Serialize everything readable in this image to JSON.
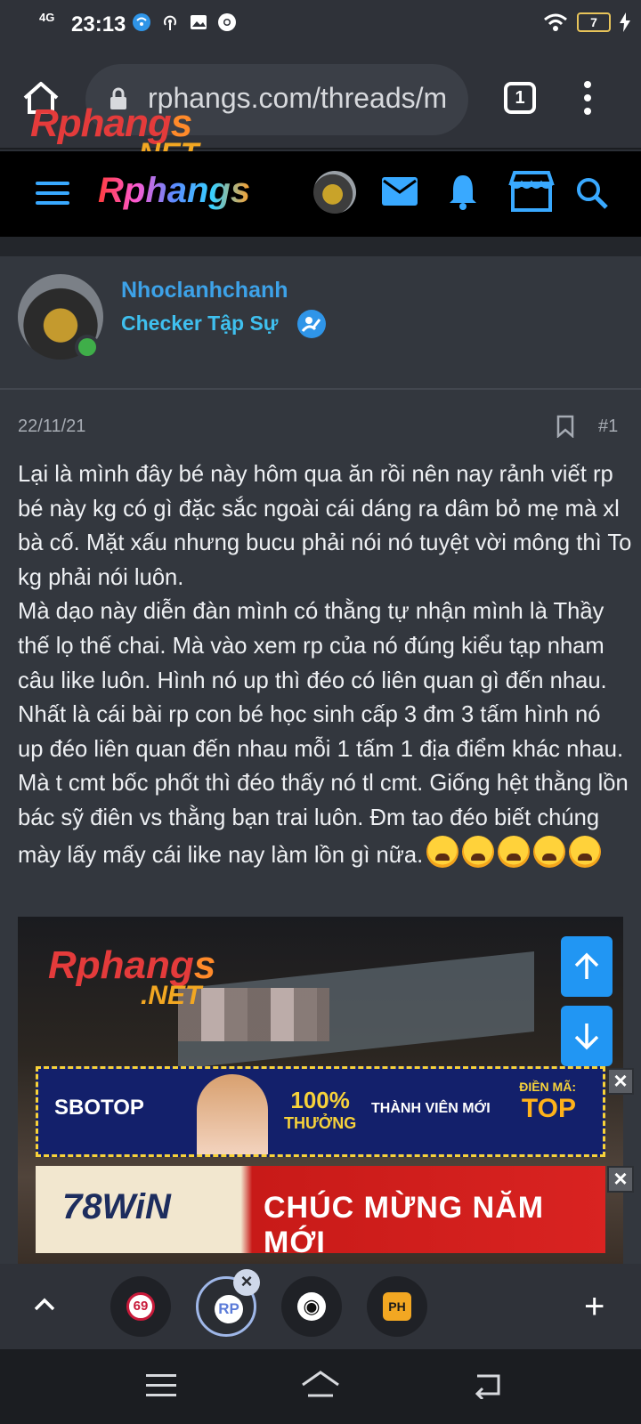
{
  "status": {
    "network": "4G",
    "time": "23:13",
    "battery": "7",
    "icons": [
      "wifi-calling-icon",
      "hotspot-icon",
      "image-icon",
      "chrome-icon"
    ]
  },
  "browser": {
    "url": "rphangs.com/threads/m",
    "tab_count": "1",
    "watermark_name": "Rphang",
    "watermark_s": "s",
    "watermark_net": ".NET"
  },
  "site": {
    "logo": "Rphangs"
  },
  "post": {
    "username": "Nhoclanhchanh",
    "user_title": "Checker Tập Sự",
    "date": "22/11/21",
    "number": "#1",
    "body": [
      "Lại là mình đây bé này hôm qua ăn rồi nên nay rảnh viết rp bé này kg có gì đặc sắc ngoài cái dáng ra dâm bỏ mẹ mà xl bà cố. Mặt xấu nhưng bucu phải nói nó tuyệt vời mông thì To kg phải nói luôn.",
      "Mà dạo này diễn đàn mình có thằng tự nhận mình là Thầy thế lọ thế chai. Mà vào xem rp của nó đúng kiểu tạp nham câu like luôn. Hình nó up thì đéo có liên quan gì đến nhau. Nhất là cái bài rp con bé học sinh cấp 3 đm 3 tấm hình nó up đéo liên quan đến nhau mỗi 1 tấm 1 địa điểm khác nhau. Mà t cmt bốc phốt thì đéo thấy nó tl cmt. Giống hệt thằng lồn bác sỹ điên vs thằng bạn trai luôn. Đm tao đéo biết chúng mày lấy mấy cái like nay làm lồn gì nữa."
    ],
    "emoji_count": 5,
    "photo_watermark_name": "Rphang",
    "photo_watermark_s": "s",
    "photo_watermark_net": ".NET"
  },
  "ads": {
    "ad1": {
      "brand": "SBOTOP",
      "percent": "100%",
      "percent_sub": "THƯỞNG",
      "middle": "THÀNH VIÊN MỚI",
      "code_label": "ĐIỀN MÃ:",
      "code": "TOP"
    },
    "ad2": {
      "brand": "78WiN",
      "text": "CHÚC MỪNG NĂM MỚI"
    },
    "close": "×"
  },
  "tabs": {
    "tab1": "69",
    "tab2": "RP",
    "tab3": "◉",
    "tab4": "PH",
    "close": "×",
    "add": "+"
  },
  "colors": {
    "accent": "#3da2e8",
    "scroll_button": "#2196f3",
    "online": "#3fae49"
  }
}
